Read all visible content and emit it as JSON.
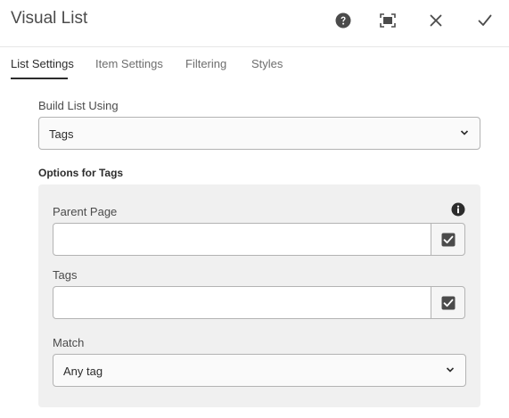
{
  "dialog": {
    "title": "Visual List",
    "icons": {
      "help": "help-icon",
      "fullscreen": "fullscreen-icon",
      "close": "close-icon",
      "done": "checkmark-icon"
    }
  },
  "tabs": [
    {
      "label": "List Settings",
      "active": true
    },
    {
      "label": "Item Settings",
      "active": false
    },
    {
      "label": "Filtering",
      "active": false
    },
    {
      "label": "Styles",
      "active": false
    }
  ],
  "build_list": {
    "label": "Build List Using",
    "selected": "Tags"
  },
  "options": {
    "title": "Options for Tags",
    "parent_page": {
      "label": "Parent Page",
      "value": "",
      "placeholder": ""
    },
    "tags": {
      "label": "Tags",
      "value": "",
      "placeholder": ""
    },
    "match": {
      "label": "Match",
      "selected": "Any tag"
    }
  },
  "colors": {
    "accent": "#2c2c2c",
    "panel_bg": "#f0f0f0",
    "border": "#b3b3b3"
  }
}
